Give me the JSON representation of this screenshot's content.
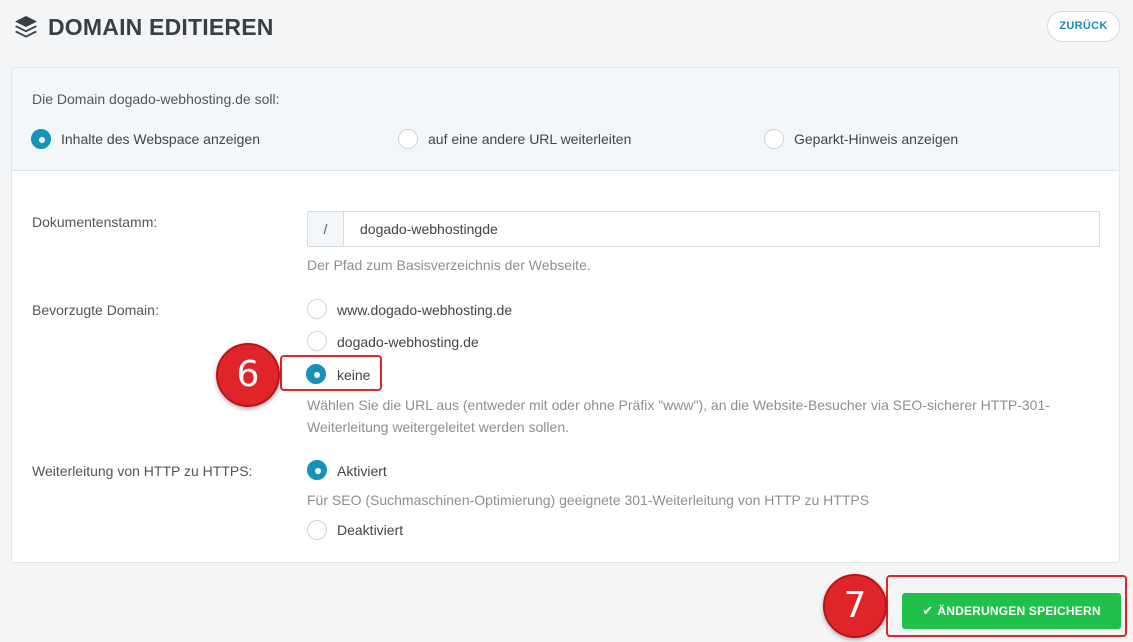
{
  "header": {
    "title": "DOMAIN EDITIEREN",
    "title_icon": "layers-icon",
    "back_label": "ZURÜCK"
  },
  "mode": {
    "intro": "Die Domain dogado-webhosting.de soll:",
    "options": [
      {
        "label": "Inhalte des Webspace anzeigen",
        "checked": true
      },
      {
        "label": "auf eine andere URL weiterleiten",
        "checked": false
      },
      {
        "label": "Geparkt-Hinweis anzeigen",
        "checked": false
      }
    ]
  },
  "document_root": {
    "label": "Dokumentenstamm:",
    "prefix": "/",
    "value": "dogado-webhostingde",
    "help": "Der Pfad zum Basisverzeichnis der Webseite."
  },
  "preferred_domain": {
    "label": "Bevorzugte Domain:",
    "options": [
      {
        "label": "www.dogado-webhosting.de",
        "checked": false
      },
      {
        "label": "dogado-webhosting.de",
        "checked": false
      },
      {
        "label": "keine",
        "checked": true
      }
    ],
    "help_line1": "Wählen Sie die URL aus (entweder mit oder ohne Präfix \"www\"), an die Website-Besucher via SEO-sicherer HTTP-301-",
    "help_line2": "Weiterleitung weitergeleitet werden sollen."
  },
  "https_redirect": {
    "label": "Weiterleitung von HTTP zu HTTPS:",
    "options": [
      {
        "label": "Aktiviert",
        "checked": true
      },
      {
        "label": "Deaktiviert",
        "checked": false
      }
    ],
    "help": "Für SEO (Suchmaschinen-Optimierung) geeignete 301-Weiterleitung von HTTP zu HTTPS"
  },
  "annotations": {
    "step6": "6",
    "step7": "7"
  },
  "footer": {
    "save_label": "ÄNDERUNGEN SPEICHERN",
    "save_icon": "check-icon"
  },
  "colors": {
    "accent": "#1691b8",
    "save": "#20c04a",
    "annotation": "#e0252a"
  }
}
